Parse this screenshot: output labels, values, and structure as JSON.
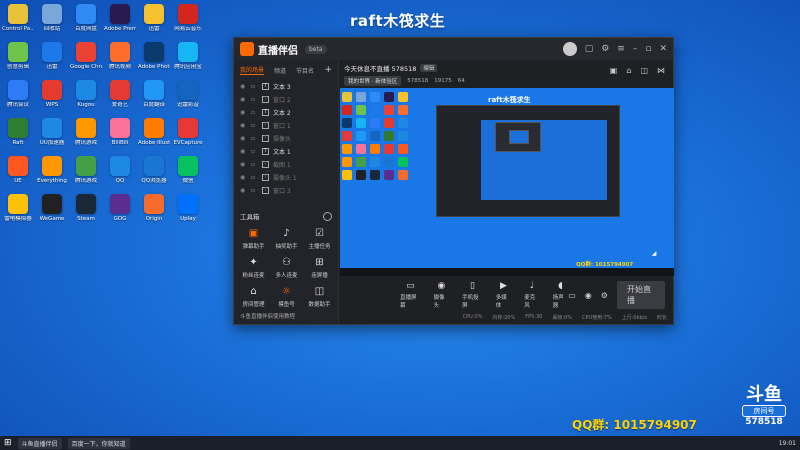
{
  "desktop": {
    "title": "raft木筏求生",
    "qq_group": "QQ群: 1015794907",
    "room_badge": {
      "logo": "斗鱼",
      "label": "房间号",
      "number": "578518"
    },
    "icons": [
      {
        "label": "Control Pa...",
        "color": "#e8c238"
      },
      {
        "label": "回收站",
        "color": "#7aa7d9"
      },
      {
        "label": "百度网盘",
        "color": "#2f8af5"
      },
      {
        "label": "Adobe Premie...",
        "color": "#2a1a52"
      },
      {
        "label": "迅雷",
        "color": "#f5c12e"
      },
      {
        "label": "网易云音乐",
        "color": "#d3261f"
      },
      {
        "label": "创意剪辑",
        "color": "#6ec44a"
      },
      {
        "label": "迅雷",
        "color": "#1e79e8"
      },
      {
        "label": "Google Chrome",
        "color": "#ea4335"
      },
      {
        "label": "腾讯视频",
        "color": "#ff6d2c"
      },
      {
        "label": "Adobe Photoshop",
        "color": "#0d3a6e"
      },
      {
        "label": "腾讯应用宝",
        "color": "#16b6f5"
      },
      {
        "label": "腾讯会议",
        "color": "#2f7bf5"
      },
      {
        "label": "WPS",
        "color": "#e53b2f"
      },
      {
        "label": "Kugou",
        "color": "#1e88e5"
      },
      {
        "label": "爱奇艺",
        "color": "#e53935"
      },
      {
        "label": "百度翻译",
        "color": "#2196f3"
      },
      {
        "label": "迅雷影音",
        "color": "#1565c0"
      },
      {
        "label": "Raft",
        "color": "#2e7d32"
      },
      {
        "label": "UU加速器",
        "color": "#1e88e5"
      },
      {
        "label": "腾讯游戏",
        "color": "#ff9800"
      },
      {
        "label": "BiliBili",
        "color": "#fb7299"
      },
      {
        "label": "Adobe Illustra...",
        "color": "#ff7c00"
      },
      {
        "label": "EVCapture",
        "color": "#e53935"
      },
      {
        "label": "UE",
        "color": "#ff5722"
      },
      {
        "label": "Everything",
        "color": "#ff9800"
      },
      {
        "label": "腾讯游戏",
        "color": "#43a047"
      },
      {
        "label": "QQ",
        "color": "#1e88e5"
      },
      {
        "label": "QQ浏览器",
        "color": "#1976d2"
      },
      {
        "label": "微信",
        "color": "#07c160"
      },
      {
        "label": "雷电模拟器",
        "color": "#ffc107"
      },
      {
        "label": "WeGame",
        "color": "#212121"
      },
      {
        "label": "Steam",
        "color": "#1b2838"
      },
      {
        "label": "GOG",
        "color": "#5c2d91"
      },
      {
        "label": "Origin",
        "color": "#f56c2d"
      },
      {
        "label": "Uplay",
        "color": "#0070ff"
      }
    ]
  },
  "window": {
    "app_name": "直播伴侣",
    "version": "beta",
    "left": {
      "tabs": [
        "我的场景",
        "频道",
        "节目名"
      ],
      "scenes": [
        {
          "label": "文本 3",
          "dim": false
        },
        {
          "label": "窗口 2",
          "dim": true
        },
        {
          "label": "文本 2",
          "dim": false
        },
        {
          "label": "窗口 1",
          "dim": true
        },
        {
          "label": "摄像头",
          "dim": true
        },
        {
          "label": "文本 1",
          "dim": false
        },
        {
          "label": "截图 1",
          "dim": true
        },
        {
          "label": "摄像头 1",
          "dim": true
        },
        {
          "label": "窗口 3",
          "dim": true
        }
      ],
      "tools_title": "工具箱",
      "tools": [
        {
          "label": "弹幕助手",
          "icon": "▣",
          "hot": true
        },
        {
          "label": "抽奖助手",
          "icon": "♪",
          "hot": false
        },
        {
          "label": "主播任务",
          "icon": "☑",
          "hot": false
        },
        {
          "label": "粉丝连麦",
          "icon": "✦",
          "hot": false
        },
        {
          "label": "多人连麦",
          "icon": "⚇",
          "hot": false
        },
        {
          "label": "连屏播",
          "icon": "⊞",
          "hot": false
        },
        {
          "label": "房间管理",
          "icon": "⌂",
          "hot": false
        },
        {
          "label": "摸鱼号",
          "icon": "☼",
          "hot": true
        },
        {
          "label": "数据助手",
          "icon": "◫",
          "hot": false
        }
      ],
      "tip": "斗鱼直播伴侣使用教程"
    },
    "room": {
      "title": "今天休息不直播 578518",
      "tag": "编辑",
      "category_pill": "我的世界 · 新体验区",
      "room_id": "578518",
      "stat1": "19175",
      "stat2": "64"
    },
    "preview": {
      "title": "raft木筏求生",
      "qq": "QQ群: 1015794907"
    },
    "controls": [
      {
        "label": "直播屏幕",
        "icon": "▭"
      },
      {
        "label": "摄像头",
        "icon": "◉"
      },
      {
        "label": "手机投屏",
        "icon": "▯"
      },
      {
        "label": "多媒体",
        "icon": "▶"
      },
      {
        "label": "麦克风",
        "icon": "♩"
      },
      {
        "label": "扬声器",
        "icon": "◖"
      }
    ],
    "go_live": "开始直播",
    "status": [
      "CPU:0%",
      "内存:20%",
      "FPS:30",
      "丢帧:0%",
      "CPU使用:7%",
      "上行:0kb/s",
      "时长"
    ]
  },
  "taskbar": {
    "start": "⊞",
    "apps": [
      "斗鱼直播伴侣",
      "百度一下，你就知道"
    ],
    "time": "19:01"
  },
  "colors": {
    "accent": "#ff6a00",
    "desktop": "#1a6fd8",
    "panel": "#1f2024"
  }
}
